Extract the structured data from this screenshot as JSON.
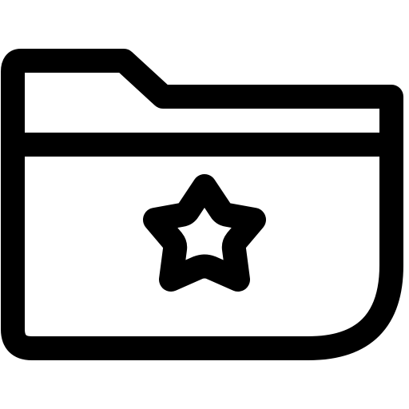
{
  "icon": {
    "name": "folder-star-icon",
    "stroke_color": "#000000",
    "background_color": "#ffffff"
  }
}
